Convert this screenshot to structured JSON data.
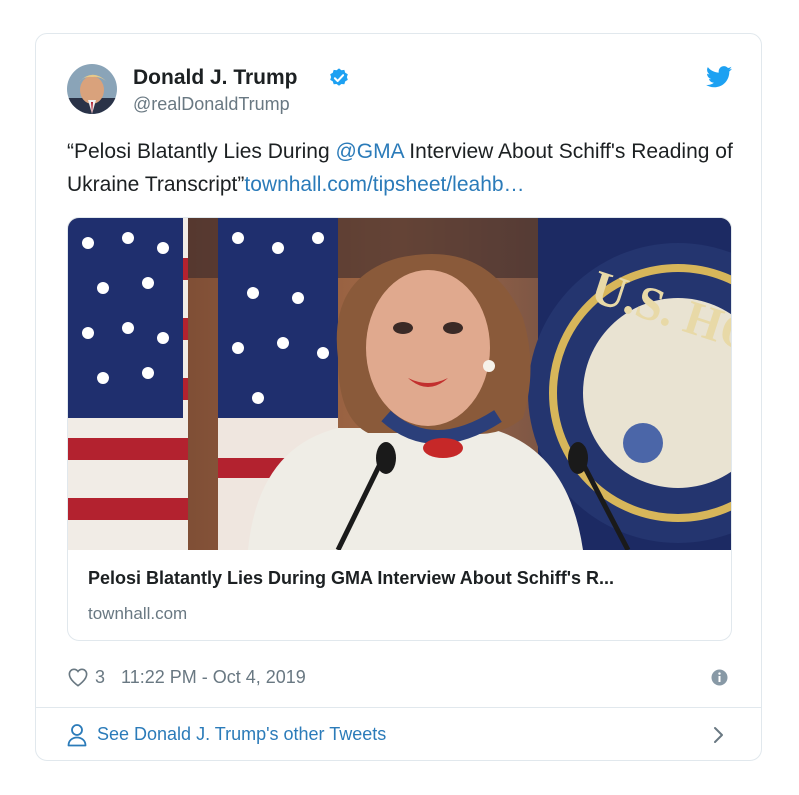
{
  "tweet": {
    "author_name": "Donald J. Trump",
    "author_handle": "@realDonaldTrump",
    "text_part1": "“Pelosi Blatantly Lies During ",
    "mention": "@GMA",
    "text_part2": " Interview About Schiff's Reading of Ukraine Transcript”",
    "url_text": "townhall.com/tipsheet/leahb…",
    "likes": "3",
    "timestamp": "11:22 PM - Oct 4, 2019"
  },
  "link_card": {
    "title": "Pelosi Blatantly Lies During GMA Interview About Schiff's R...",
    "domain": "townhall.com"
  },
  "footer": {
    "label": "See Donald J. Trump's other Tweets"
  },
  "colors": {
    "link": "#2b7bb9",
    "secondary_text": "#697882",
    "border": "#e1e8ed",
    "verified": "#1da1f2"
  },
  "icons": [
    "verified-badge-icon",
    "twitter-bird-icon",
    "heart-icon",
    "info-icon",
    "person-icon",
    "chevron-right-icon"
  ]
}
